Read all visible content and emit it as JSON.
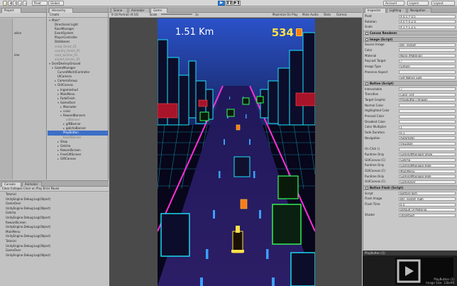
{
  "toolbar": {
    "buttons": [
      "Pivot",
      "Global"
    ],
    "right_buttons": [
      "Account",
      "Layers",
      "Layout"
    ],
    "play": "▶",
    "pause": "❚❚",
    "step": "▶❚"
  },
  "hierarchy": {
    "tab": "Hierarchy",
    "create": "Create",
    "items": [
      {
        "label": "Main*",
        "indent": 0,
        "arrow": "▾"
      },
      {
        "label": "Directional Light",
        "indent": 1
      },
      {
        "label": "RaceManager",
        "indent": 1
      },
      {
        "label": "EventSystem",
        "indent": 1
      },
      {
        "label": "PlayerController",
        "indent": 1
      },
      {
        "label": "Databases",
        "indent": 1
      },
      {
        "label": "snow_forest_01",
        "indent": 1,
        "dim": true
      },
      {
        "label": "country_forest_01",
        "indent": 1,
        "dim": true
      },
      {
        "label": "road_section_01",
        "indent": 1,
        "dim": true
      },
      {
        "label": "airport_terrain_01",
        "indent": 1,
        "dim": true
      },
      {
        "label": "DontDestroyOnLoad",
        "indent": 0,
        "arrow": "▾"
      },
      {
        "label": "GameManager",
        "indent": 1,
        "arrow": "▾"
      },
      {
        "label": "CurvedWorldController",
        "indent": 2
      },
      {
        "label": "UICamera",
        "indent": 2
      },
      {
        "label": "CameraGroup",
        "indent": 2,
        "arrow": "▸"
      },
      {
        "label": "GUICanvas",
        "indent": 2,
        "arrow": "▾"
      },
      {
        "label": "Ingameshud",
        "indent": 3,
        "arrow": "▸"
      },
      {
        "label": "MainMenu",
        "indent": 3,
        "arrow": "▸"
      },
      {
        "label": "FadeFinish",
        "indent": 3,
        "arrow": "▸"
      },
      {
        "label": "GameOver",
        "indent": 3,
        "arrow": "▾"
      },
      {
        "label": "Marcador",
        "indent": 4,
        "arrow": "▸"
      },
      {
        "label": "coins",
        "indent": 4,
        "arrow": "▸"
      },
      {
        "label": "RewardBanners",
        "indent": 4,
        "arrow": "▾"
      },
      {
        "label": "adBanner",
        "indent": 5,
        "dim": true
      },
      {
        "label": "giftBanner",
        "indent": 5,
        "arrow": "▸"
      },
      {
        "label": "gatchaBanner",
        "indent": 5,
        "arrow": "▸"
      },
      {
        "label": "PlayButton",
        "indent": 4,
        "sel": true
      },
      {
        "label": "boostBanner",
        "indent": 4,
        "dim": true
      },
      {
        "label": "Shop",
        "indent": 3,
        "arrow": "▸"
      },
      {
        "label": "Gatcha",
        "indent": 3,
        "arrow": "▸"
      },
      {
        "label": "RewardScreen",
        "indent": 3,
        "arrow": "▸"
      },
      {
        "label": "FreeGiftScreen",
        "indent": 3,
        "arrow": "▸"
      },
      {
        "label": "GiftCanvas",
        "indent": 3,
        "arrow": "▸"
      }
    ]
  },
  "project": {
    "tab": "Project",
    "items": [
      "",
      "",
      "",
      "ation",
      "",
      "",
      "",
      "",
      "ime",
      "",
      "",
      ""
    ]
  },
  "console": {
    "tabs": [
      "Console",
      "Animator"
    ],
    "bar": "Clear  Collapse  Clear on Play  Error Pause",
    "entries": [
      "Tutorial",
      "UnityEngine.Debug:Log(Object)",
      "GameOver",
      "UnityEngine.Debug:Log(Object)",
      "Gatcha",
      "UnityEngine.Debug:Log(Object)",
      "RewardScreen",
      "UnityEngine.Debug:Log(Object)",
      "MainMenu",
      "UnityEngine.Debug:Log(Object)",
      "Tutorial",
      "UnityEngine.Debug:Log(Object)",
      "GameOver",
      "UnityEngine.Debug:Log(Object)"
    ]
  },
  "gameview": {
    "tabs": [
      "Scene",
      "Animator",
      "Game"
    ],
    "bar_left": "9:16 Portrait (9:16)",
    "bar_scale": "Scale",
    "bar_zoom": "1x",
    "bar_right": [
      "Maximize On Play",
      "Mute Audio",
      "Stats",
      "Gizmos"
    ]
  },
  "hud": {
    "distance": "1.51 Km",
    "coins": "534"
  },
  "inspector": {
    "tabs": [
      "Inspector",
      "Lighting",
      "Navigation"
    ],
    "rows": [
      {
        "type": "field",
        "label": "Pivot",
        "value": "X 0.5   Y 0.5"
      },
      {
        "type": "field",
        "label": "Rotation",
        "value": "X 0   Y 0   Z 0"
      },
      {
        "type": "field",
        "label": "Scale",
        "value": "X 1   Y 1   Z 1"
      },
      {
        "type": "head",
        "label": "Canvas Renderer"
      },
      {
        "type": "head",
        "label": "Image (Script)"
      },
      {
        "type": "field",
        "label": "Source Image",
        "value": "btn_restart"
      },
      {
        "type": "field",
        "label": "Color",
        "value": ""
      },
      {
        "type": "field",
        "label": "Material",
        "value": "None (Material)"
      },
      {
        "type": "field",
        "label": "Raycast Target",
        "value": "✓"
      },
      {
        "type": "field",
        "label": "Image Type",
        "value": "Simple"
      },
      {
        "type": "field",
        "label": "Preserve Aspect",
        "value": ""
      },
      {
        "type": "field",
        "label": "",
        "value": "Set Native Size"
      },
      {
        "type": "head",
        "label": "Button (Script)"
      },
      {
        "type": "field",
        "label": "Interactable",
        "value": "✓"
      },
      {
        "type": "field",
        "label": "Transition",
        "value": "Color Tint"
      },
      {
        "type": "field",
        "label": "Target Graphic",
        "value": "PlayButton (Image)"
      },
      {
        "type": "field",
        "label": "Normal Color",
        "value": ""
      },
      {
        "type": "field",
        "label": "Highlighted Color",
        "value": ""
      },
      {
        "type": "field",
        "label": "Pressed Color",
        "value": ""
      },
      {
        "type": "field",
        "label": "Disabled Color",
        "value": ""
      },
      {
        "type": "field",
        "label": "Color Multiplier",
        "value": "1"
      },
      {
        "type": "field",
        "label": "Fade Duration",
        "value": "0.1"
      },
      {
        "type": "field",
        "label": "Navigation",
        "value": "Automatic"
      },
      {
        "type": "field",
        "label": "",
        "value": "Visualize"
      },
      {
        "type": "field",
        "label": "On Click ()",
        "value": ""
      },
      {
        "type": "field",
        "label": "Runtime Only",
        "value": "GameUIManager.Show"
      },
      {
        "type": "field",
        "label": "GUICanvas (C)",
        "value": "Gatcha"
      },
      {
        "type": "field",
        "label": "Runtime Only",
        "value": "GameUIManager.Hide"
      },
      {
        "type": "field",
        "label": "GUICanvas (C)",
        "value": "MainMenu"
      },
      {
        "type": "field",
        "label": "Runtime Only",
        "value": "GameUIManager.Hide"
      },
      {
        "type": "field",
        "label": "GUICanvas (C)",
        "value": "GameOver"
      },
      {
        "type": "head",
        "label": "Button Flash (Script)"
      },
      {
        "type": "field",
        "label": "Script",
        "value": "ButtonFlash"
      },
      {
        "type": "field",
        "label": "Flash Image",
        "value": "btn_restart_high"
      },
      {
        "type": "field",
        "label": "Flash Time",
        "value": "0.5"
      },
      {
        "type": "field",
        "label": "",
        "value": "Default UI Material"
      },
      {
        "type": "field",
        "label": "Shader",
        "value": "UI/Default"
      }
    ]
  },
  "preview": {
    "title": "PlayButton (1)",
    "caption_1": "PlayButton (1)",
    "caption_2": "Image Size: 128x96"
  },
  "colors": {
    "neon_cyan": "#19e6ff",
    "neon_magenta": "#ff2fd9",
    "neon_green": "#36ff5a",
    "road": "#2a1f5c",
    "coin": "#ff7a1a"
  }
}
